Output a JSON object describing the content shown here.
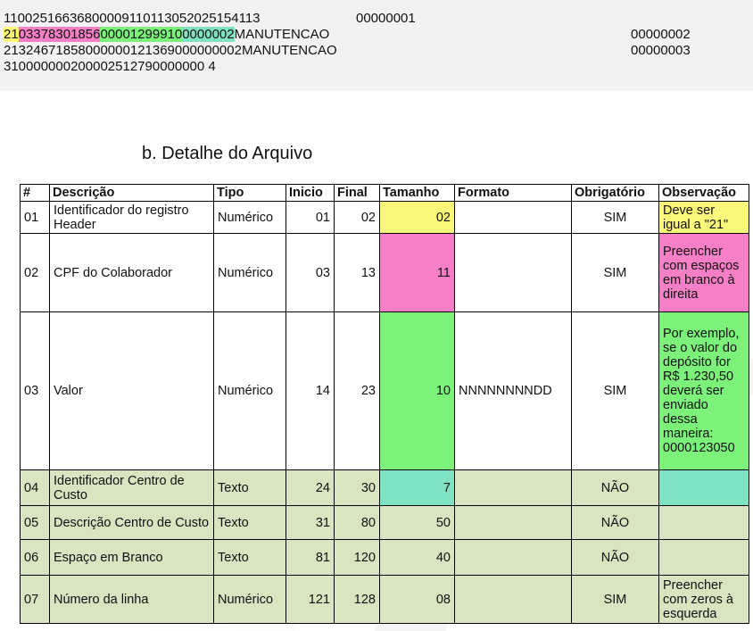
{
  "code_lines": {
    "line1": "1100251663680000911011305202515411300000001",
    "line1_main": "11002516636800009110113052025154113",
    "line1_num": "00000001",
    "line2": {
      "seg_yellow": "21",
      "seg_pink": "03378301856",
      "seg_green": "00001299910",
      "seg_teal": "0000002",
      "rest": "MANUTENCAO",
      "num": "00000002"
    },
    "line3": {
      "text": "21324671858000000121369000000002MANUTENCAO",
      "num": "00000003"
    },
    "line4": "310000000200002512790000000 4"
  },
  "section_title": "b.  Detalhe do Arquivo",
  "table": {
    "headers": {
      "num": "#",
      "descricao": "Descrição",
      "tipo": "Tipo",
      "inicio": "Inicio",
      "final": "Final",
      "tamanho": "Tamanho",
      "formato": "Formato",
      "obrigatorio": "Obrigatório",
      "observacao": "Observação"
    },
    "rows": [
      {
        "num": "01",
        "descricao": "Identificador do registro Header",
        "tipo": "Numérico",
        "inicio": "01",
        "final": "02",
        "tamanho": "02",
        "formato": "",
        "obrigatorio": "SIM",
        "observacao": "Deve ser igual a \"21\""
      },
      {
        "num": "02",
        "descricao": "CPF do Colaborador",
        "tipo": "Numérico",
        "inicio": "03",
        "final": "13",
        "tamanho": "11",
        "formato": "",
        "obrigatorio": "SIM",
        "observacao": "Preencher com espaços em branco à direita"
      },
      {
        "num": "03",
        "descricao": "Valor",
        "tipo": "Numérico",
        "inicio": "14",
        "final": "23",
        "tamanho": "10",
        "formato": "NNNNNNNNDD",
        "obrigatorio": "SIM",
        "observacao": "Por exemplo, se o valor do depósito for R$ 1.230,50 deverá ser enviado dessa maneira: 0000123050"
      },
      {
        "num": "04",
        "descricao": "Identificador Centro de Custo",
        "tipo": "Texto",
        "inicio": "24",
        "final": "30",
        "tamanho": "7",
        "formato": "",
        "obrigatorio": "NÃO",
        "observacao": ""
      },
      {
        "num": "05",
        "descricao": "Descrição Centro de Custo",
        "tipo": "Texto",
        "inicio": "31",
        "final": "80",
        "tamanho": "50",
        "formato": "",
        "obrigatorio": "NÃO",
        "observacao": ""
      },
      {
        "num": "06",
        "descricao": "Espaço em Branco",
        "tipo": "Texto",
        "inicio": "81",
        "final": "120",
        "tamanho": "40",
        "formato": "",
        "obrigatorio": "NÃO",
        "observacao": ""
      },
      {
        "num": "07",
        "descricao": "Número da linha",
        "tipo": "Numérico",
        "inicio": "121",
        "final": "128",
        "tamanho": "08",
        "formato": "",
        "obrigatorio": "SIM",
        "observacao": "Preencher com zeros à esquerda"
      }
    ]
  },
  "colors": {
    "yellow": "#fbf77a",
    "pink": "#f77fc6",
    "green": "#7cf27a",
    "teal": "#7fe3c3",
    "row_tint": "#d9e4c0"
  }
}
